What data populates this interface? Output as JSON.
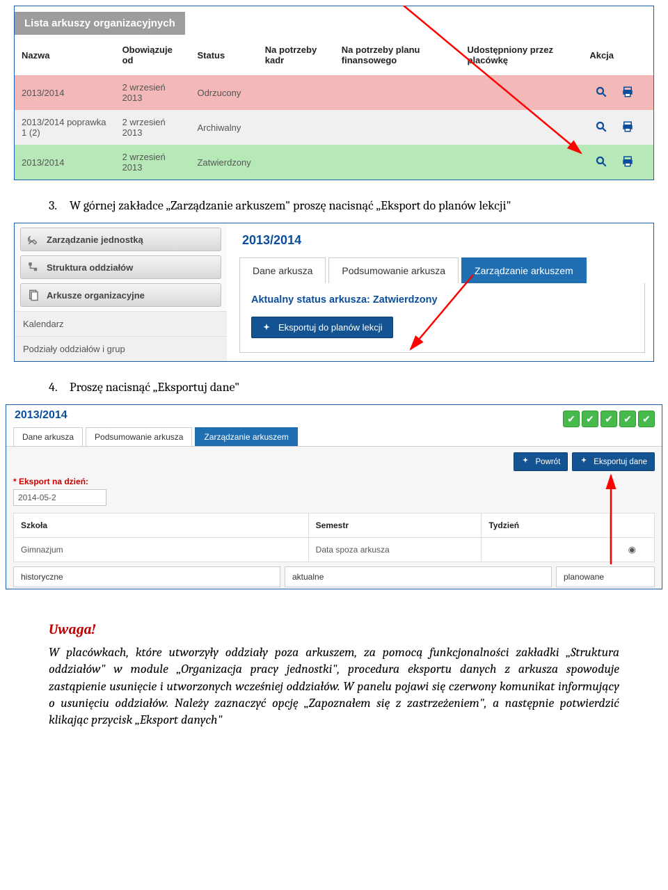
{
  "screenshot1": {
    "title": "Lista arkuszy organizacyjnych",
    "headers": {
      "c0": "Nazwa",
      "c1": "Obowiązuje od",
      "c2": "Status",
      "c3": "Na potrzeby kadr",
      "c4": "Na potrzeby planu finansowego",
      "c5": "Udostępniony przez placówkę",
      "c6": "Akcja"
    },
    "rows": [
      {
        "c0": "2013/2014",
        "c1": "2 wrzesień 2013",
        "c2": "Odrzucony"
      },
      {
        "c0": "2013/2014 poprawka 1 (2)",
        "c1": "2 wrzesień 2013",
        "c2": "Archiwalny"
      },
      {
        "c0": "2013/2014",
        "c1": "2 wrzesień 2013",
        "c2": "Zatwierdzony"
      }
    ]
  },
  "step3_num": "3.",
  "step3_text": "W górnej zakładce „Zarządzanie arkuszem\" proszę nacisnąć „Eksport do planów lekcji\"",
  "screenshot2": {
    "nav": {
      "n0": "Zarządzanie jednostką",
      "n1": "Struktura oddziałów",
      "n2": "Arkusze organizacyjne",
      "n3": "Kalendarz",
      "n4": "Podziały oddziałów i grup"
    },
    "year": "2013/2014",
    "tabs": {
      "t0": "Dane arkusza",
      "t1": "Podsumowanie arkusza",
      "t2": "Zarządzanie arkuszem"
    },
    "status_label": "Aktualny status arkusza: ",
    "status_value": "Zatwierdzony",
    "export_btn": "Eksportuj do planów lekcji"
  },
  "step4_num": "4.",
  "step4_text": "Proszę nacisnąć „Eksportuj dane\"",
  "screenshot3": {
    "year": "2013/2014",
    "tabs": {
      "t0": "Dane arkusza",
      "t1": "Podsumowanie arkusza",
      "t2": "Zarządzanie arkuszem"
    },
    "btn_back": "Powrót",
    "btn_export": "Eksportuj dane",
    "export_on_day": "* Eksport na dzień:",
    "date_value": "2014-05-2",
    "th": {
      "c0": "Szkoła",
      "c1": "Semestr",
      "c2": "Tydzień"
    },
    "row": {
      "c0": "Gimnazjum",
      "c1": "Data spoza arkusza",
      "c2": ""
    },
    "bt": {
      "b0": "historyczne",
      "b1": "aktualne",
      "b2": "planowane"
    }
  },
  "warning": {
    "title": "Uwaga!",
    "body": "W placówkach, które utworzyły oddziały poza arkuszem, za pomocą funkcjonalności zakładki „Struktura oddziałów\" w module „Organizacja pracy jednostki\", procedura eksportu danych z arkusza spowoduje zastąpienie usunięcie i utworzonych wcześniej oddziałów. W panelu pojawi się czerwony komunikat informujący o usunięciu oddziałów. Należy zaznaczyć opcję „Zapoznałem się z zastrzeżeniem\", a następnie potwierdzić klikając przycisk „Eksport danych\""
  }
}
